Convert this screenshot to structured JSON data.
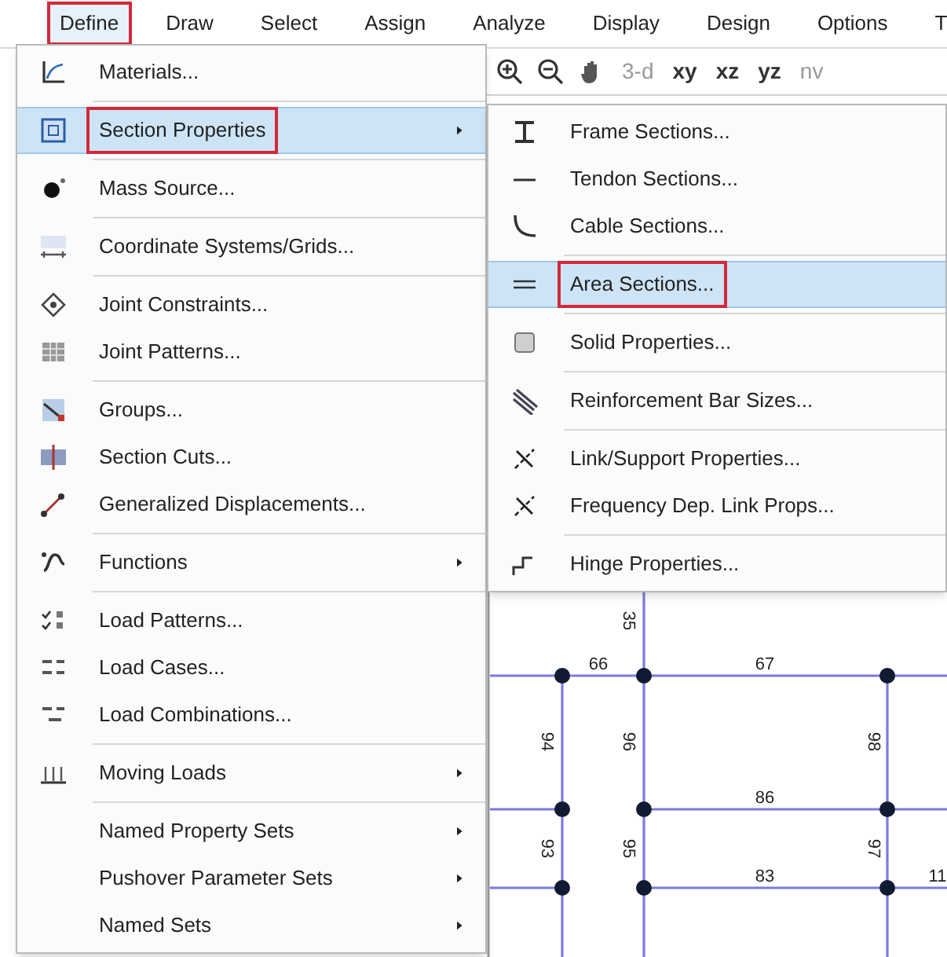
{
  "menu_bar": [
    {
      "label": "Define",
      "selected": true,
      "outlined": true
    },
    {
      "label": "Draw",
      "selected": false,
      "outlined": false
    },
    {
      "label": "Select",
      "selected": false,
      "outlined": false
    },
    {
      "label": "Assign",
      "selected": false,
      "outlined": false
    },
    {
      "label": "Analyze",
      "selected": false,
      "outlined": false
    },
    {
      "label": "Display",
      "selected": false,
      "outlined": false
    },
    {
      "label": "Design",
      "selected": false,
      "outlined": false
    },
    {
      "label": "Options",
      "selected": false,
      "outlined": false
    },
    {
      "label": "T",
      "selected": false,
      "outlined": false
    }
  ],
  "toolbar": [
    {
      "label": "3-d",
      "disabled": true
    },
    {
      "label": "xy",
      "disabled": false
    },
    {
      "label": "xz",
      "disabled": false
    },
    {
      "label": "yz",
      "disabled": false
    },
    {
      "label": "nv",
      "disabled": true
    }
  ],
  "define_menu": [
    [
      {
        "label": "Materials...",
        "submenu": false,
        "selected": false,
        "outlined": false
      }
    ],
    [
      {
        "label": "Section Properties",
        "submenu": true,
        "selected": true,
        "outlined": true
      }
    ],
    [
      {
        "label": "Mass Source...",
        "submenu": false,
        "selected": false,
        "outlined": false
      }
    ],
    [
      {
        "label": "Coordinate Systems/Grids...",
        "submenu": false,
        "selected": false,
        "outlined": false
      }
    ],
    [
      {
        "label": "Joint Constraints...",
        "submenu": false,
        "selected": false,
        "outlined": false
      },
      {
        "label": "Joint Patterns...",
        "submenu": false,
        "selected": false,
        "outlined": false
      }
    ],
    [
      {
        "label": "Groups...",
        "submenu": false,
        "selected": false,
        "outlined": false
      },
      {
        "label": "Section Cuts...",
        "submenu": false,
        "selected": false,
        "outlined": false
      },
      {
        "label": "Generalized Displacements...",
        "submenu": false,
        "selected": false,
        "outlined": false
      }
    ],
    [
      {
        "label": "Functions",
        "submenu": true,
        "selected": false,
        "outlined": false
      }
    ],
    [
      {
        "label": "Load Patterns...",
        "submenu": false,
        "selected": false,
        "outlined": false
      },
      {
        "label": "Load Cases...",
        "submenu": false,
        "selected": false,
        "outlined": false
      },
      {
        "label": "Load Combinations...",
        "submenu": false,
        "selected": false,
        "outlined": false
      }
    ],
    [
      {
        "label": "Moving Loads",
        "submenu": true,
        "selected": false,
        "outlined": false
      }
    ],
    [
      {
        "label": "Named Property Sets",
        "submenu": true,
        "selected": false,
        "outlined": false
      },
      {
        "label": "Pushover Parameter Sets",
        "submenu": true,
        "selected": false,
        "outlined": false
      },
      {
        "label": "Named Sets",
        "submenu": true,
        "selected": false,
        "outlined": false
      }
    ]
  ],
  "section_properties_menu": [
    [
      {
        "label": "Frame Sections...",
        "selected": false,
        "outlined": false
      },
      {
        "label": "Tendon Sections...",
        "selected": false,
        "outlined": false
      },
      {
        "label": "Cable Sections...",
        "selected": false,
        "outlined": false
      }
    ],
    [
      {
        "label": "Area Sections...",
        "selected": true,
        "outlined": true
      }
    ],
    [
      {
        "label": "Solid Properties...",
        "selected": false,
        "outlined": false
      }
    ],
    [
      {
        "label": "Reinforcement Bar Sizes...",
        "selected": false,
        "outlined": false
      }
    ],
    [
      {
        "label": "Link/Support Properties...",
        "selected": false,
        "outlined": false
      },
      {
        "label": "Frequency Dep. Link Props...",
        "selected": false,
        "outlined": false
      }
    ],
    [
      {
        "label": "Hinge Properties...",
        "selected": false,
        "outlined": false
      }
    ]
  ],
  "canvas": {
    "labels": [
      "35",
      "66",
      "67",
      "94",
      "96",
      "98",
      "86",
      "93",
      "95",
      "97",
      "83",
      "11"
    ]
  }
}
